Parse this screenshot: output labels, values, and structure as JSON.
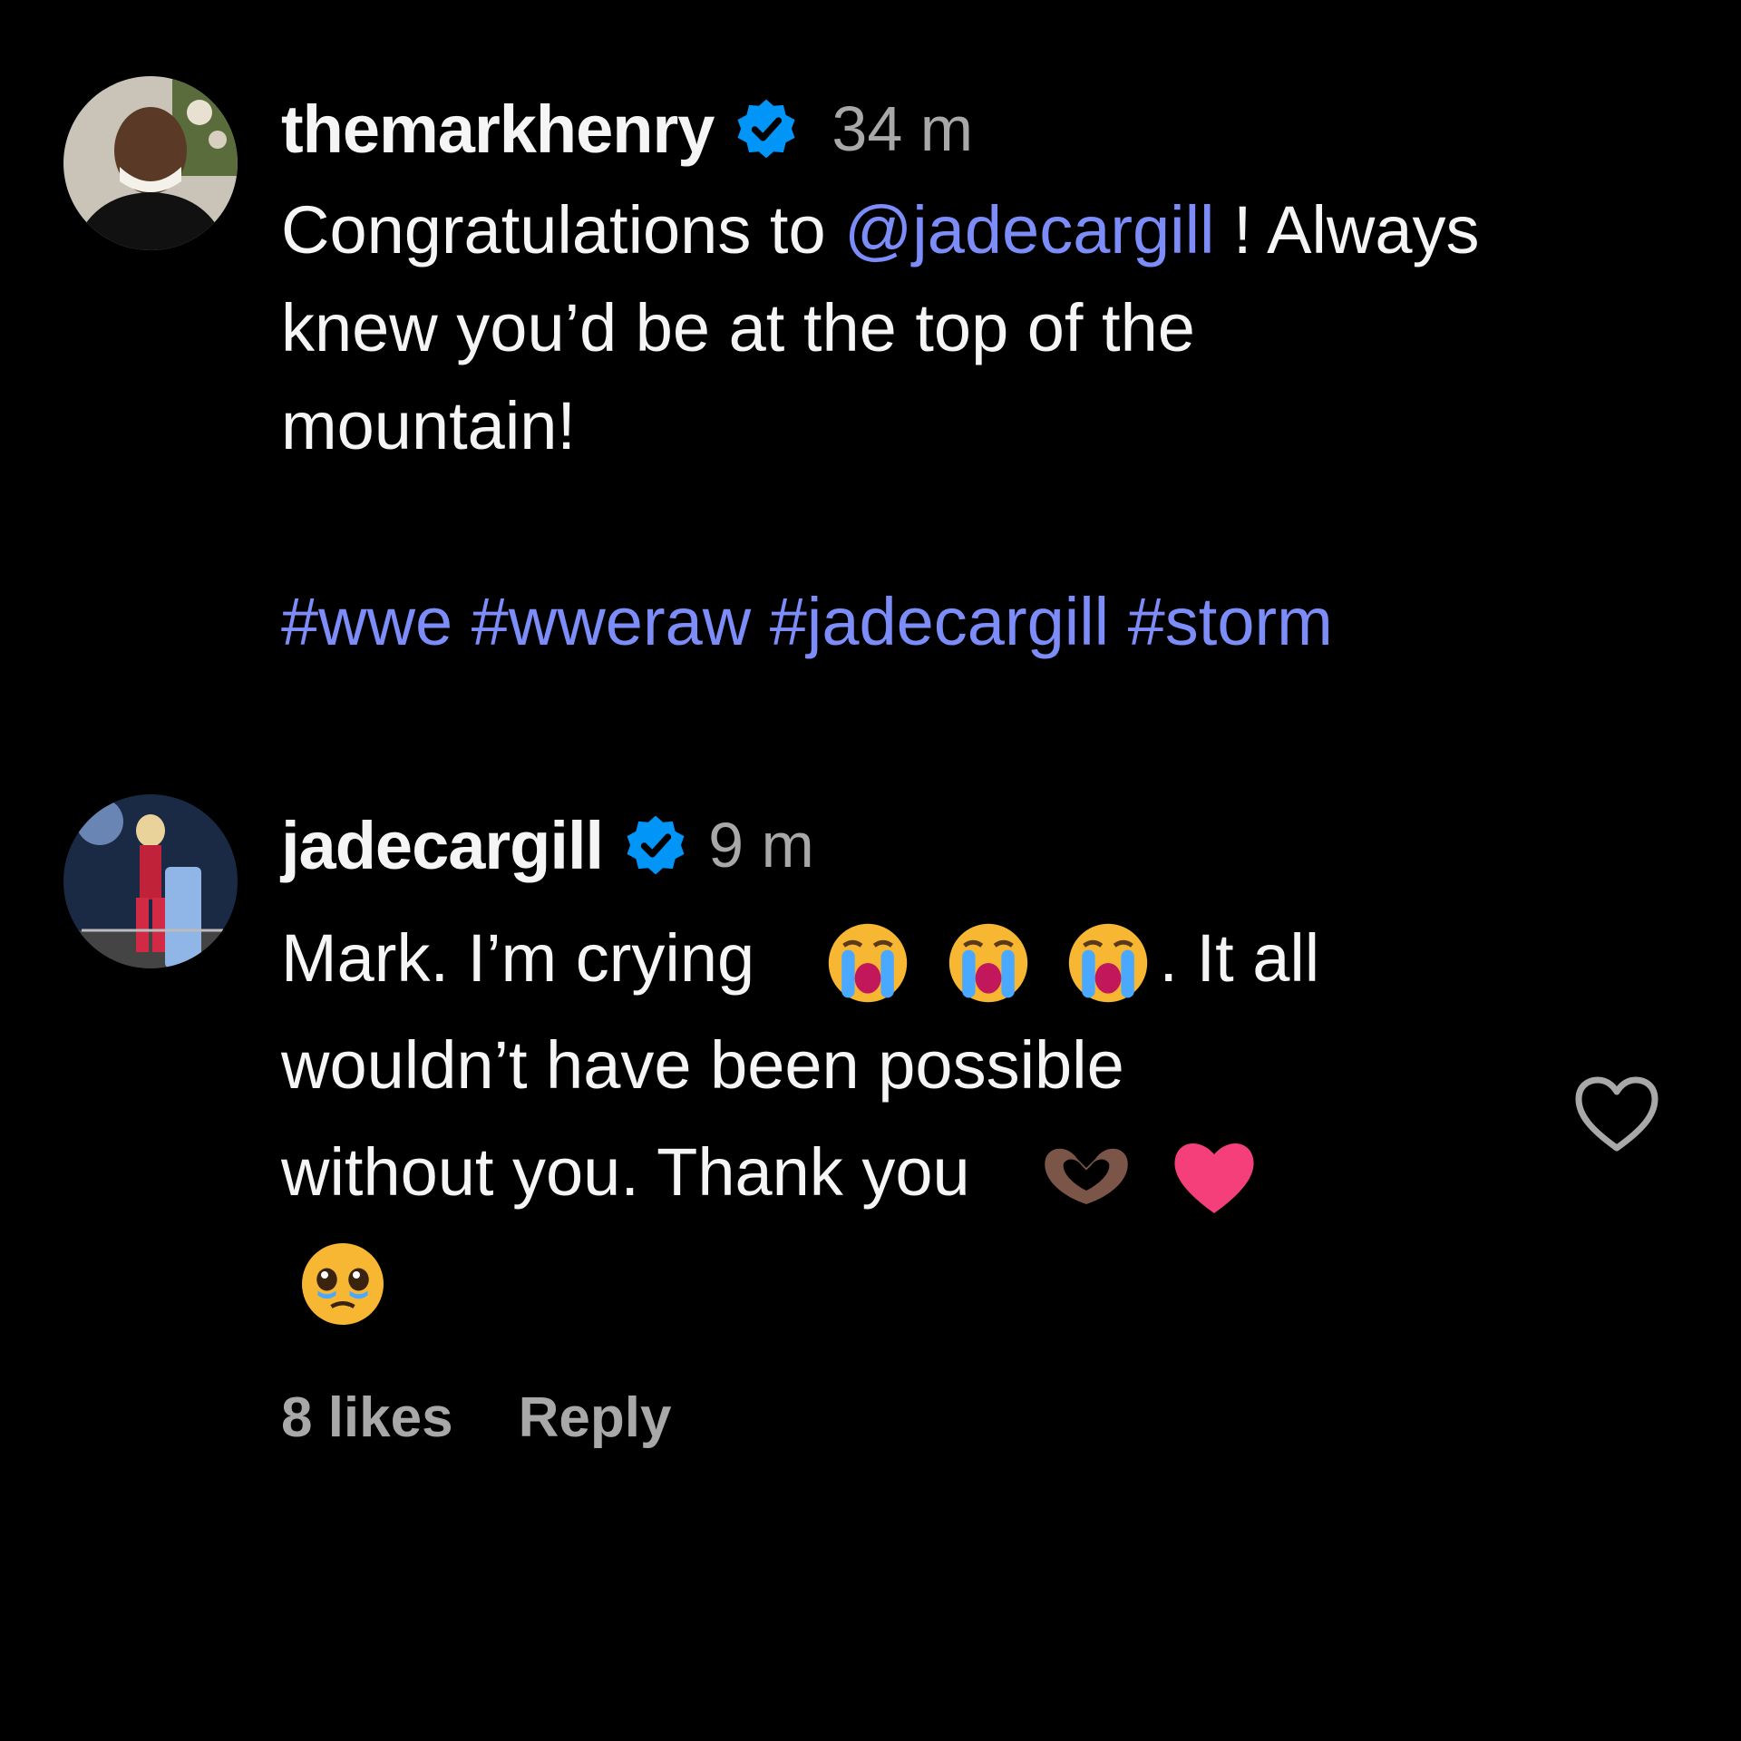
{
  "comments": [
    {
      "username": "themarkhenry",
      "verified": true,
      "time": "34 m",
      "body": {
        "prefix": "Congratulations to ",
        "mention": "@jadecargill",
        "after_mention": " ! Always",
        "line2": "knew you’d be at the top of the",
        "line3": "mountain!",
        "hashtags": "#wwe #wweraw #jadecargill #storm"
      }
    },
    {
      "username": "jadecargill",
      "verified": true,
      "time": "9 m",
      "body": {
        "line1_text": "Mark. I’m crying",
        "line1_after": ". It all",
        "line2": "wouldn’t have been possible",
        "line3": "without you. Thank you"
      },
      "emojis": [
        "loudly-crying-face",
        "loudly-crying-face",
        "loudly-crying-face",
        "heart-hands",
        "red-heart",
        "face-holding-back-tears"
      ],
      "likes": "8 likes",
      "reply": "Reply"
    }
  ],
  "colors": {
    "background": "#000000",
    "text": "#f5f5f5",
    "muted": "#a8a8a8",
    "link": "#7c8cf8",
    "verified": "#0095f6"
  },
  "icons": [
    "verified-badge-icon",
    "heart-outline-icon"
  ]
}
